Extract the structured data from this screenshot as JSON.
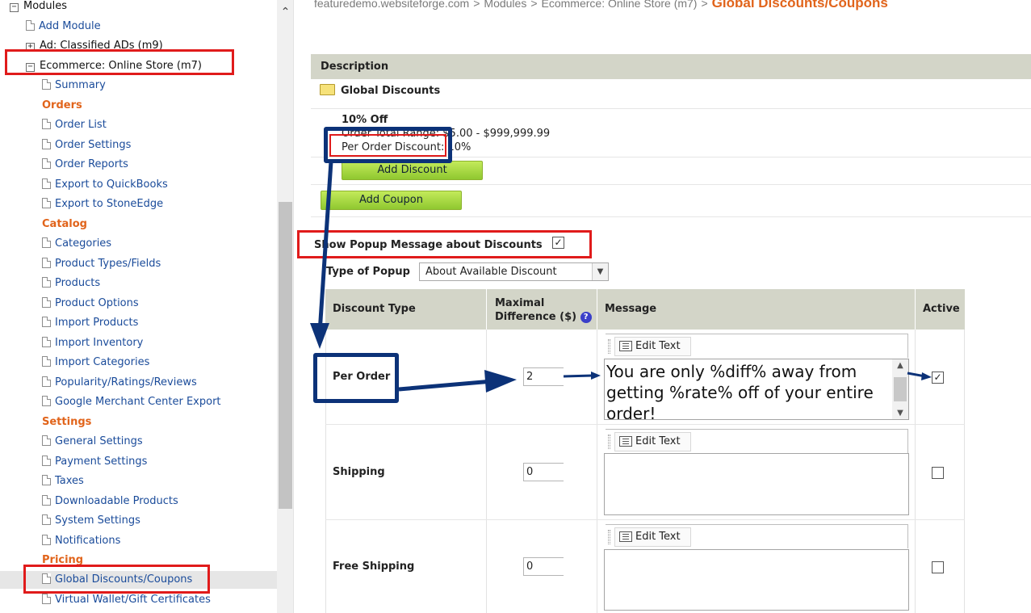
{
  "sidebar": {
    "items": [
      {
        "kind": "tree",
        "toggle": "−",
        "label": "Modules"
      },
      {
        "kind": "link",
        "label": "Add Module"
      },
      {
        "kind": "tree",
        "toggle": "+",
        "label": "Ad: Classified ADs (m9)"
      },
      {
        "kind": "tree",
        "toggle": "−",
        "label": "Ecommerce: Online Store (m7)"
      },
      {
        "kind": "link",
        "label": "Summary"
      },
      {
        "kind": "section",
        "label": "Orders"
      },
      {
        "kind": "link",
        "label": "Order List"
      },
      {
        "kind": "link",
        "label": "Order Settings"
      },
      {
        "kind": "link",
        "label": "Order Reports"
      },
      {
        "kind": "link",
        "label": "Export to QuickBooks"
      },
      {
        "kind": "link",
        "label": "Export to StoneEdge"
      },
      {
        "kind": "section",
        "label": "Catalog"
      },
      {
        "kind": "link",
        "label": "Categories"
      },
      {
        "kind": "link",
        "label": "Product Types/Fields"
      },
      {
        "kind": "link",
        "label": "Products"
      },
      {
        "kind": "link",
        "label": "Product Options"
      },
      {
        "kind": "link",
        "label": "Import Products"
      },
      {
        "kind": "link",
        "label": "Import Inventory"
      },
      {
        "kind": "link",
        "label": "Import Categories"
      },
      {
        "kind": "link",
        "label": "Popularity/Ratings/Reviews"
      },
      {
        "kind": "link",
        "label": "Google Merchant Center Export"
      },
      {
        "kind": "section",
        "label": "Settings"
      },
      {
        "kind": "link",
        "label": "General Settings"
      },
      {
        "kind": "link",
        "label": "Payment Settings"
      },
      {
        "kind": "link",
        "label": "Taxes"
      },
      {
        "kind": "link",
        "label": "Downloadable Products"
      },
      {
        "kind": "link",
        "label": "System Settings"
      },
      {
        "kind": "link",
        "label": "Notifications"
      },
      {
        "kind": "section",
        "label": "Pricing"
      },
      {
        "kind": "link",
        "label": "Global Discounts/Coupons",
        "selected": true
      },
      {
        "kind": "link",
        "label": "Virtual Wallet/Gift Certificates"
      }
    ]
  },
  "breadcrumb": {
    "site": "featuredemo.websiteforge.com",
    "sep": ">",
    "module": "Modules",
    "section": "Ecommerce: Online Store (m7)",
    "current": "Global Discounts/Coupons"
  },
  "description": {
    "header": "Description",
    "folder_label": "Global Discounts",
    "discount_name": "10% Off",
    "discount_range": "Order Total Range: $5.00 - $999,999.99",
    "discount_rate": "Per Order Discount: 10%",
    "add_discount_label": "Add Discount",
    "add_coupon_label": "Add Coupon"
  },
  "popup": {
    "label": "Show Popup Message about Discounts",
    "checked": "✓",
    "type_label": "Type of Popup",
    "type_value": "About Available Discount",
    "select_arrow": "▼"
  },
  "discount_table": {
    "headers": {
      "type": "Discount Type",
      "max_diff_line1": "Maximal",
      "max_diff_line2": "Difference ($)",
      "help": "?",
      "message": "Message",
      "active": "Active"
    },
    "edit_text_label": "Edit Text",
    "rows": [
      {
        "type": "Per Order",
        "max_diff": "2",
        "message": "You are only %diff% away from getting %rate% off of your entire order!",
        "active": "✓"
      },
      {
        "type": "Shipping",
        "max_diff": "0",
        "message": "",
        "active": ""
      },
      {
        "type": "Free Shipping",
        "max_diff": "0",
        "message": "",
        "active": ""
      }
    ]
  },
  "icons": {
    "scroll_up": "⌃",
    "arrow_up": "▲",
    "arrow_down": "▼"
  },
  "colors": {
    "link": "#1a4b9a",
    "section": "#e1641b",
    "header_bg": "#d3d5c8",
    "button_green": "#a7d63f",
    "annotation_red": "#e01b1b",
    "annotation_blue": "#0c3278"
  }
}
